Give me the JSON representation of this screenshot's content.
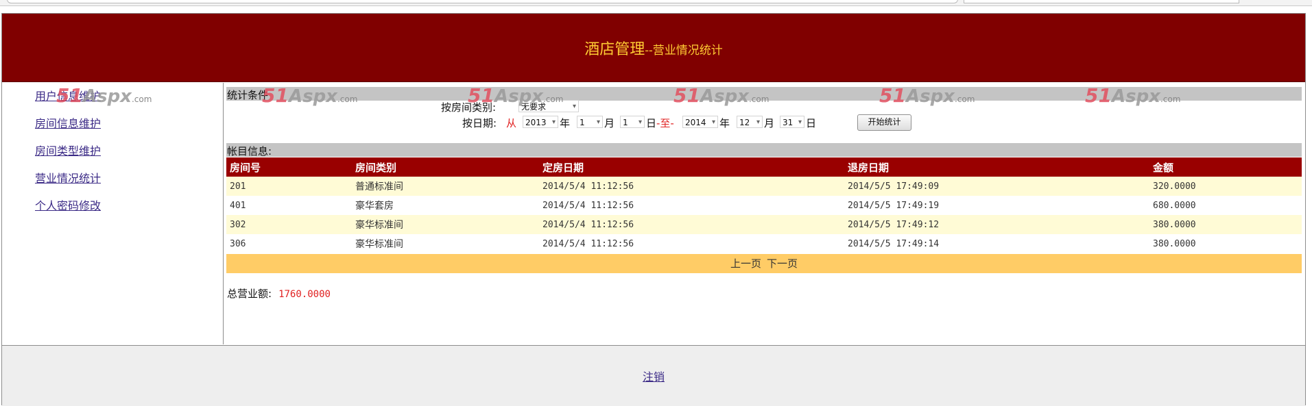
{
  "header": {
    "title": "酒店管理",
    "subtitle": "--营业情况统计"
  },
  "sidebar": {
    "items": [
      {
        "label": "用户信息维护"
      },
      {
        "label": "房间信息维护"
      },
      {
        "label": "房间类型维护"
      },
      {
        "label": "营业情况统计"
      },
      {
        "label": "个人密码修改"
      }
    ]
  },
  "filters": {
    "section_label": "统计条件",
    "room_type_label": "按房间类别:",
    "room_type_value": "无要求",
    "date_label": "按日期:",
    "from_label": "从",
    "to_label": "-至-",
    "start": {
      "year": "2013",
      "month": "1",
      "day": "1"
    },
    "end": {
      "year": "2014",
      "month": "12",
      "day": "31"
    },
    "unit_year": "年",
    "unit_month": "月",
    "unit_day": "日",
    "start_button": "开始统计"
  },
  "records": {
    "section_label": "帐目信息:",
    "columns": [
      "房间号",
      "房间类别",
      "定房日期",
      "退房日期",
      "金额"
    ],
    "rows": [
      [
        "201",
        "普通标准间",
        "2014/5/4 11:12:56",
        "2014/5/5 17:49:09",
        "320.0000"
      ],
      [
        "401",
        "豪华套房",
        "2014/5/4 11:12:56",
        "2014/5/5 17:49:19",
        "680.0000"
      ],
      [
        "302",
        "豪华标准间",
        "2014/5/4 11:12:56",
        "2014/5/5 17:49:12",
        "380.0000"
      ],
      [
        "306",
        "豪华标准间",
        "2014/5/4 11:12:56",
        "2014/5/5 17:49:14",
        "380.0000"
      ]
    ],
    "pager": {
      "prev": "上一页",
      "next": "下一页"
    },
    "total_label": "总营业额:",
    "total_value": "1760.0000"
  },
  "footer": {
    "logout_label": "注销"
  },
  "watermark": {
    "num": "51",
    "brand": "Aspx",
    "suffix": ".com"
  },
  "colors": {
    "header_bg": "#800000",
    "title": "#ffcc33",
    "table_header": "#990000",
    "pager_bg": "#ffcc66",
    "row_alt": "#fffbd6"
  }
}
